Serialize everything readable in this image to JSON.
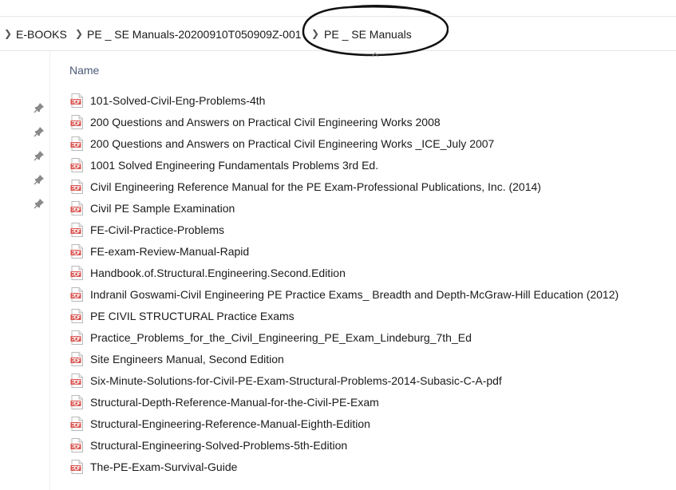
{
  "breadcrumb": {
    "items": [
      {
        "label": "E-BOOKS"
      },
      {
        "label": "PE _ SE Manuals-20200910T050909Z-001"
      },
      {
        "label": "PE _ SE Manuals"
      }
    ],
    "separator_icon": "chevron-right-icon"
  },
  "file_list": {
    "column_header": "Name",
    "file_icon": "pdf-file-icon",
    "pin_icon": "pin-icon",
    "icon_color": "#d9534f",
    "files": [
      "101-Solved-Civil-Eng-Problems-4th",
      "200 Questions and Answers on Practical Civil Engineering  Works 2008",
      "200 Questions and Answers on Practical Civil Engineering Works _ICE_July 2007",
      "1001 Solved Engineering Fundamentals Problems 3rd Ed.",
      "Civil Engineering Reference Manual for the PE Exam-Professional Publications, Inc. (2014)",
      "Civil PE Sample Examination",
      "FE-Civil-Practice-Problems",
      "FE-exam-Review-Manual-Rapid",
      "Handbook.of.Structural.Engineering.Second.Edition",
      "Indranil Goswami-Civil Engineering PE Practice Exams_ Breadth and Depth-McGraw-Hill Education (2012)",
      "PE CIVIL STRUCTURAL Practice Exams",
      "Practice_Problems_for_the_Civil_Engineering_PE_Exam_Lindeburg_7th_Ed",
      "Site Engineers Manual, Second Edition",
      "Six-Minute-Solutions-for-Civil-PE-Exam-Structural-Problems-2014-Subasic-C-A-pdf",
      "Structural-Depth-Reference-Manual-for-the-Civil-PE-Exam",
      "Structural-Engineering-Reference-Manual-Eighth-Edition",
      "Structural-Engineering-Solved-Problems-5th-Edition",
      "The-PE-Exam-Survival-Guide"
    ]
  }
}
